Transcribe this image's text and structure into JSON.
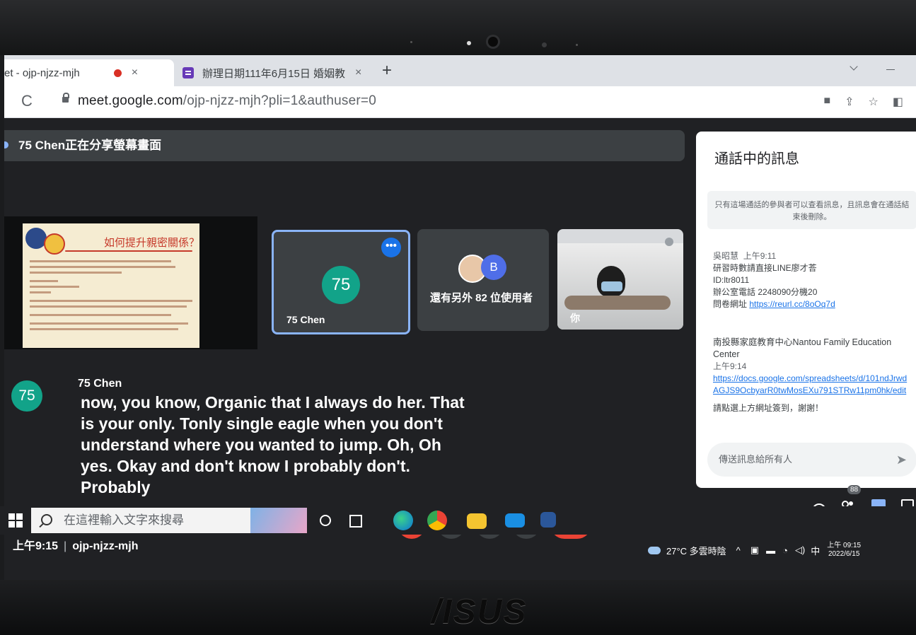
{
  "browser": {
    "tab1_title": "et - ojp-njzz-mjh",
    "tab1_close": "×",
    "tab2_title": "辦理日期111年6月15日 婚姻教",
    "tab2_close": "×",
    "new_tab": "+",
    "url_domain": "meet.google.com",
    "url_path": "/ojp-njzz-mjh?pli=1&authuser=0"
  },
  "meet": {
    "share_banner": "75 Chen正在分享螢幕畫面",
    "slide_title": "如何提升親密關係？",
    "tiles": [
      {
        "avatar_text": "75",
        "name": "75 Chen",
        "avatar_color": "#12a389"
      },
      {
        "extra_initial": "B",
        "name": "還有另外 82 位使用者"
      },
      {
        "name": "你"
      }
    ],
    "more_glyph": "•••",
    "caption": {
      "avatar_text": "75",
      "speaker": "75 Chen",
      "text": "now, you know, Organic that I always do her. That is your only. Tonly single eagle when you don't understand where you wanted to jump. Oh, Oh yes. Okay and don't know I probably don't. Probably"
    },
    "time": "上午9:15",
    "separator": "|",
    "meeting_code": "ojp-njzz-mjh",
    "people_count": "88",
    "hangup_color": "#ea4335"
  },
  "chat": {
    "title": "通話中的訊息",
    "notice": "只有這場通話的參與者可以查看訊息，且訊息會在通話結束後刪除。",
    "messages": [
      {
        "sender": "吳昭慧",
        "time": "上午9:11",
        "lines": [
          "研習時數請直接LINE廖才荅",
          "ID:ltr8011",
          "辦公室電話 2248090分機20"
        ],
        "link_label": "問卷網址",
        "link": "https://reurl.cc/8oOq7d"
      },
      {
        "sender": "南投縣家庭教育中心Nantou Family Education Center",
        "time": "上午9:14",
        "link": "https://docs.google.com/spreadsheets/d/101ndJrwdAGJS9OcbyarR0twMosEXu791STRw11pm0hk/edit",
        "after": "請點選上方網址簽到，謝謝！"
      }
    ],
    "input_placeholder": "傳送訊息給所有人",
    "send_glyph": "➤"
  },
  "taskbar": {
    "search_placeholder": "在這裡輸入文字來搜尋",
    "weather": "27°C 多雲時陰",
    "ime": "中",
    "clock_time": "上午 09:15",
    "clock_date": "2022/6/15"
  },
  "laptop": {
    "brand": "/ISUS"
  }
}
